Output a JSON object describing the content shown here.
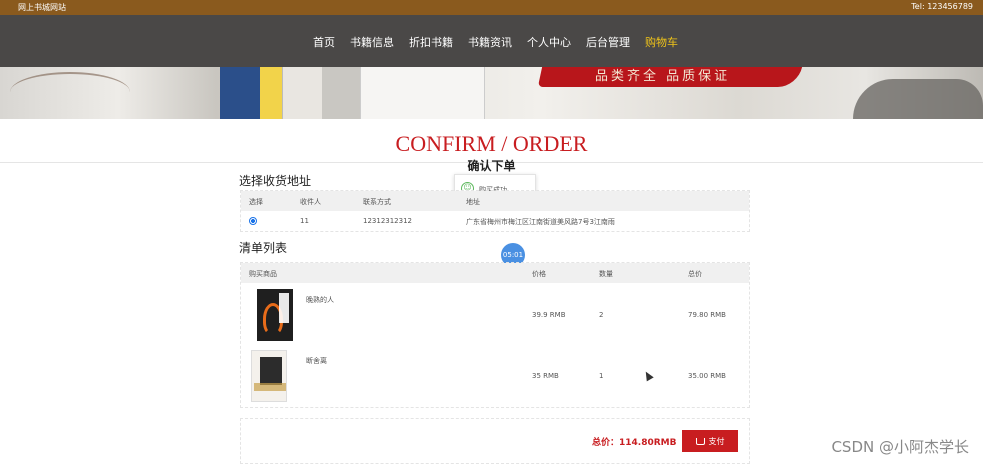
{
  "topbar": {
    "site_name": "网上书城网站",
    "tel": "Tel:  123456789"
  },
  "nav": {
    "items": [
      {
        "label": "首页"
      },
      {
        "label": "书籍信息"
      },
      {
        "label": "折扣书籍"
      },
      {
        "label": "书籍资讯"
      },
      {
        "label": "个人中心"
      },
      {
        "label": "后台管理"
      },
      {
        "label": "购物车"
      }
    ],
    "active_color": "#f0c419"
  },
  "banner": {
    "slogan": "品类齐全  品质保证"
  },
  "page": {
    "heading_en": "CONFIRM / ORDER",
    "heading_cn": "确认下单"
  },
  "toast": {
    "message": "购买成功"
  },
  "address": {
    "section_title": "选择收货地址",
    "headers": {
      "select": "选择",
      "receiver": "收件人",
      "phone": "联系方式",
      "addr": "地址"
    },
    "rows": [
      {
        "receiver": "11",
        "phone": "12312312312",
        "addr": "广东省梅州市梅江区江南街道美风路7号3江南雨"
      }
    ]
  },
  "timer": {
    "label": "05:01"
  },
  "cart": {
    "section_title": "清单列表",
    "headers": {
      "product": "购买商品",
      "price": "价格",
      "qty": "数量",
      "subtotal": "总价"
    },
    "rows": [
      {
        "name": "晚熟的人",
        "price": "39.9 RMB",
        "qty": "2",
        "subtotal": "79.80 RMB"
      },
      {
        "name": "断舍离",
        "price": "35 RMB",
        "qty": "1",
        "subtotal": "35.00 RMB"
      }
    ]
  },
  "summary": {
    "total_label": "总价：114.80RMB",
    "pay_label": "支付"
  },
  "watermark": "CSDN @小阿杰学长",
  "colors": {
    "accent_red": "#c81d20",
    "nav_bg": "#4a4847",
    "topbar_bg": "#8a5a1e"
  }
}
